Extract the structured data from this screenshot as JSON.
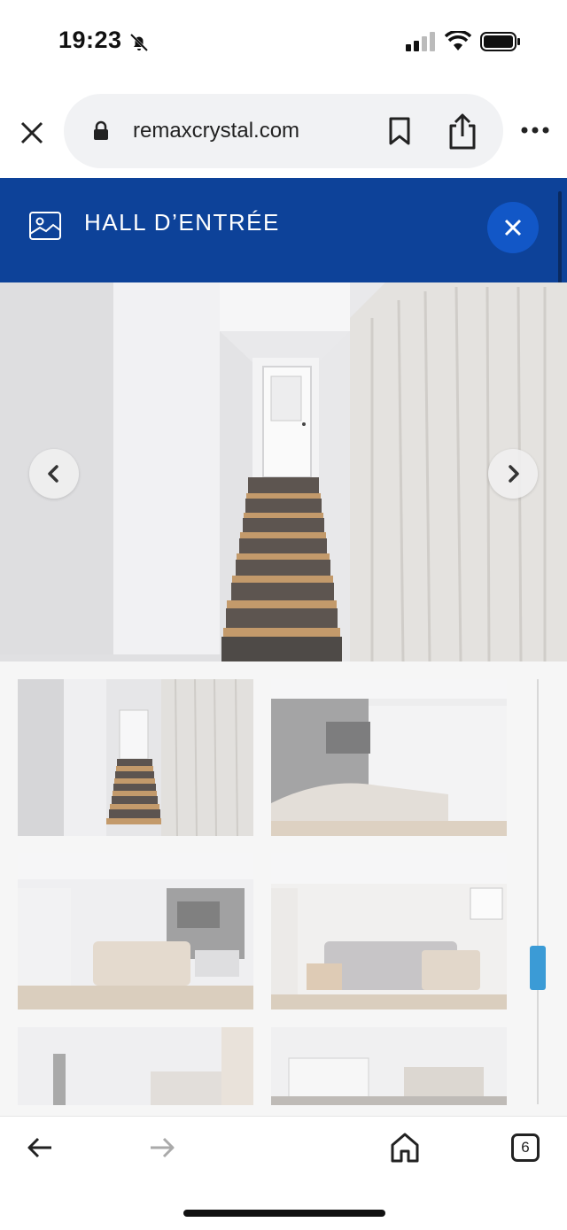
{
  "status": {
    "time": "19:23"
  },
  "browser": {
    "url": "remaxcrystal.com",
    "tab_count": "6"
  },
  "banner": {
    "title": "HALL D’ENTRÉE"
  },
  "gallery": {
    "thumbnails": [
      {
        "name": "thumb-hall-stairs"
      },
      {
        "name": "thumb-living-room-tv"
      },
      {
        "name": "thumb-living-room-sofa"
      },
      {
        "name": "thumb-living-room-window"
      },
      {
        "name": "thumb-kitchen-1"
      },
      {
        "name": "thumb-kitchen-2"
      }
    ],
    "scroll_position": 0.62
  },
  "colors": {
    "banner": "#0d4299",
    "banner_close": "#1257c7",
    "scroll_thumb": "#3b9bd6"
  },
  "icons": [
    "bell-off-icon",
    "signal-icon",
    "wifi-icon",
    "battery-icon",
    "close-icon",
    "lock-icon",
    "bookmark-icon",
    "share-icon",
    "more-icon",
    "image-icon",
    "chevron-left-icon",
    "chevron-right-icon",
    "back-arrow-icon",
    "forward-arrow-icon",
    "home-icon",
    "tabs-icon"
  ]
}
